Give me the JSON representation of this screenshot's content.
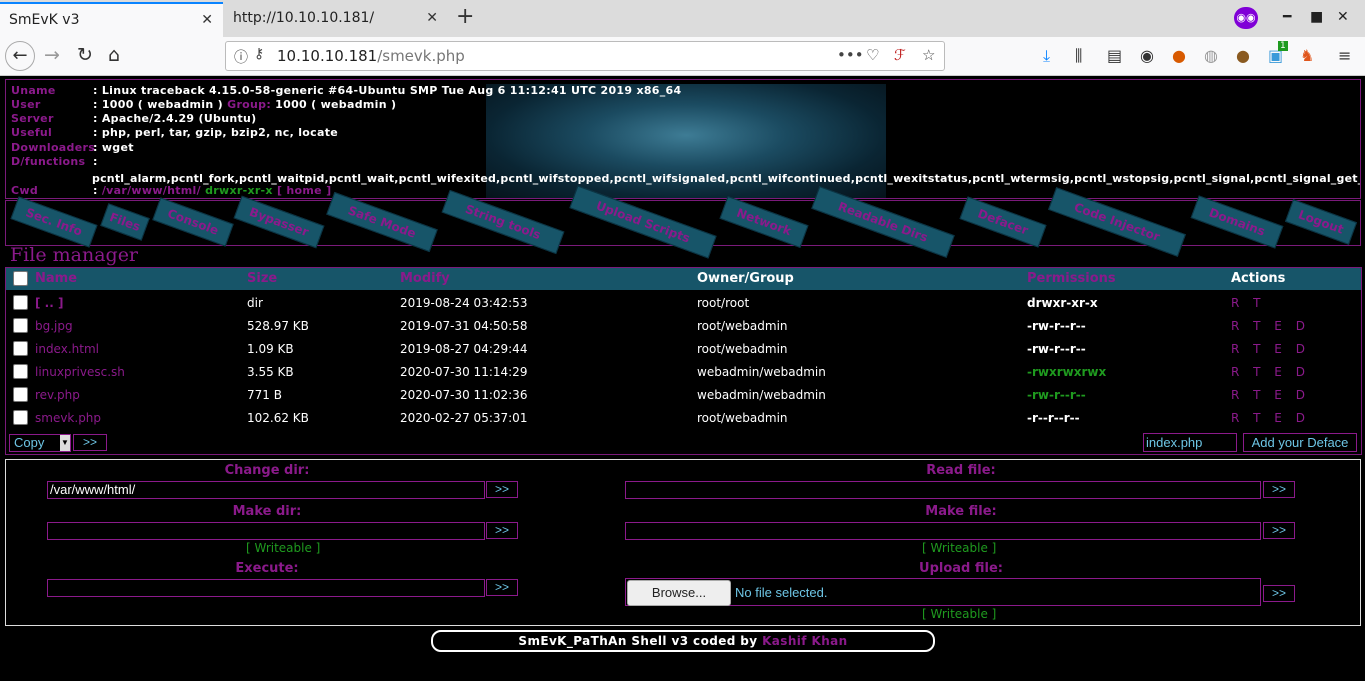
{
  "browser": {
    "tabs": [
      {
        "title": "SmEvK v3"
      },
      {
        "title": "http://10.10.10.181/"
      }
    ],
    "url_host": "10.10.10.181",
    "url_path": "/smevk.php",
    "badge_count": "1"
  },
  "sysinfo": [
    {
      "key": "Uname",
      "value": "Linux traceback 4.15.0-58-generic #64-Ubuntu SMP Tue Aug 6 11:12:41 UTC 2019 x86_64"
    },
    {
      "key": "User",
      "value": "1000 ( webadmin )",
      "group_label": "Group:",
      "group_value": "1000 ( webadmin )"
    },
    {
      "key": "Server",
      "value": "Apache/2.4.29 (Ubuntu)"
    },
    {
      "key": "Useful",
      "value": "php, perl, tar, gzip, bzip2, nc, locate"
    },
    {
      "key": "Downloaders",
      "value": "wget"
    },
    {
      "key": "D/functions",
      "value": ""
    },
    {
      "key": "Cwd",
      "path": "/var/www/html/",
      "perm": "drwxr-xr-x",
      "home": "[ home ]"
    }
  ],
  "disabled_functions": "pcntl_alarm,pcntl_fork,pcntl_waitpid,pcntl_wait,pcntl_wifexited,pcntl_wifstopped,pcntl_wifsignaled,pcntl_wifcontinued,pcntl_wexitstatus,pcntl_wtermsig,pcntl_wstopsig,pcntl_signal,pcntl_signal_get_handler",
  "menu": [
    "Sec. Info",
    "Files",
    "Console",
    "Bypasser",
    "Safe Mode",
    "String tools",
    "Upload Scripts",
    "Network",
    "Readable Dirs",
    "Defacer",
    "Code Injector",
    "Domains",
    "Logout"
  ],
  "file_manager": {
    "title": "File manager",
    "columns": [
      "Name",
      "Size",
      "Modify",
      "Owner/Group",
      "Permissions",
      "Actions"
    ],
    "rows": [
      {
        "name": "[ .. ]",
        "size": "dir",
        "modify": "2019-08-24 03:42:53",
        "owner": "root/root",
        "perms": "drwxr-xr-x",
        "perm_color": "#ffffff",
        "actions": "R T"
      },
      {
        "name": "bg.jpg",
        "size": "528.97 KB",
        "modify": "2019-07-31 04:50:58",
        "owner": "root/webadmin",
        "perms": "-rw-r--r--",
        "perm_color": "#ffffff",
        "actions": "R T E D"
      },
      {
        "name": "index.html",
        "size": "1.09 KB",
        "modify": "2019-08-27 04:29:44",
        "owner": "root/webadmin",
        "perms": "-rw-r--r--",
        "perm_color": "#ffffff",
        "actions": "R T E D"
      },
      {
        "name": "linuxprivesc.sh",
        "size": "3.55 KB",
        "modify": "2020-07-30 11:14:29",
        "owner": "webadmin/webadmin",
        "perms": "-rwxrwxrwx",
        "perm_color": "#1f9a1f",
        "actions": "R T E D"
      },
      {
        "name": "rev.php",
        "size": "771 B",
        "modify": "2020-07-30 11:02:36",
        "owner": "webadmin/webadmin",
        "perms": "-rw-r--r--",
        "perm_color": "#1f9a1f",
        "actions": "R T E D"
      },
      {
        "name": "smevk.php",
        "size": "102.62 KB",
        "modify": "2020-02-27 05:37:01",
        "owner": "root/webadmin",
        "perms": "-r--r--r--",
        "perm_color": "#ffffff",
        "actions": "R T E D"
      }
    ],
    "bulk_action": "Copy",
    "go_label": ">>",
    "deface_file": "index.php",
    "deface_button": "Add your Deface"
  },
  "tools": {
    "change_dir": {
      "label": "Change dir:",
      "value": "/var/www/html/"
    },
    "read_file": {
      "label": "Read file:"
    },
    "make_dir": {
      "label": "Make dir:"
    },
    "make_file": {
      "label": "Make file:"
    },
    "execute": {
      "label": "Execute:"
    },
    "upload_file": {
      "label": "Upload file:",
      "browse": "Browse...",
      "status": "No file selected."
    },
    "writeable": "[ Writeable ]",
    "go": ">>"
  },
  "footer": {
    "text": "SmEvK_PaThAn Shell v3 coded by",
    "author": "Kashif Khan"
  },
  "colors": {
    "accent": "#8b1a8b",
    "header_bg": "#175569",
    "green": "#1f9a1f"
  }
}
